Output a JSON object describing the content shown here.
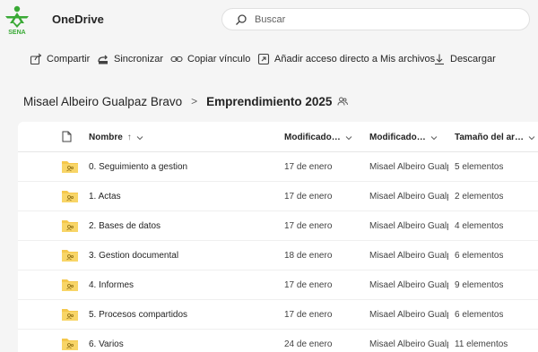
{
  "header": {
    "app_name": "OneDrive",
    "search_placeholder": "Buscar"
  },
  "commands": [
    {
      "label": "Compartir",
      "icon": "share-icon"
    },
    {
      "label": "Sincronizar",
      "icon": "sync-icon"
    },
    {
      "label": "Copiar vínculo",
      "icon": "link-icon"
    },
    {
      "label": "Añadir acceso directo a Mis archivos",
      "icon": "shortcut-icon"
    },
    {
      "label": "Descargar",
      "icon": "download-icon"
    }
  ],
  "breadcrumb": {
    "root": "Misael Albeiro Gualpaz Bravo",
    "separator": ">",
    "current": "Emprendimiento 2025"
  },
  "columns": {
    "file_type_icon": "document-icon",
    "name": "Nombre",
    "name_sort": "↑",
    "modified": "Modificado…",
    "modified_by": "Modificado…",
    "size": "Tamaño del ar…"
  },
  "rows": [
    {
      "name": "0. Seguimiento a gestion",
      "modified": "17 de enero",
      "modified_by": "Misael Albeiro Gualpaz Bravo",
      "size": "5 elementos"
    },
    {
      "name": "1. Actas",
      "modified": "17 de enero",
      "modified_by": "Misael Albeiro Gualpaz Bravo",
      "size": "2 elementos"
    },
    {
      "name": "2. Bases de datos",
      "modified": "17 de enero",
      "modified_by": "Misael Albeiro Gualpaz Bravo",
      "size": "4 elementos"
    },
    {
      "name": "3. Gestion documental",
      "modified": "18 de enero",
      "modified_by": "Misael Albeiro Gualpaz Bravo",
      "size": "6 elementos"
    },
    {
      "name": "4. Informes",
      "modified": "17 de enero",
      "modified_by": "Misael Albeiro Gualpaz Bravo",
      "size": "9 elementos"
    },
    {
      "name": "5. Procesos compartidos",
      "modified": "17 de enero",
      "modified_by": "Misael Albeiro Gualpaz Bravo",
      "size": "6 elementos"
    },
    {
      "name": "6. Varios",
      "modified": "24 de enero",
      "modified_by": "Misael Albeiro Gualpaz Bravo",
      "size": "11 elementos"
    }
  ],
  "colors": {
    "logo_green": "#39a935",
    "folder_yellow": "#f5c84c",
    "folder_dark": "#e3a92a"
  }
}
